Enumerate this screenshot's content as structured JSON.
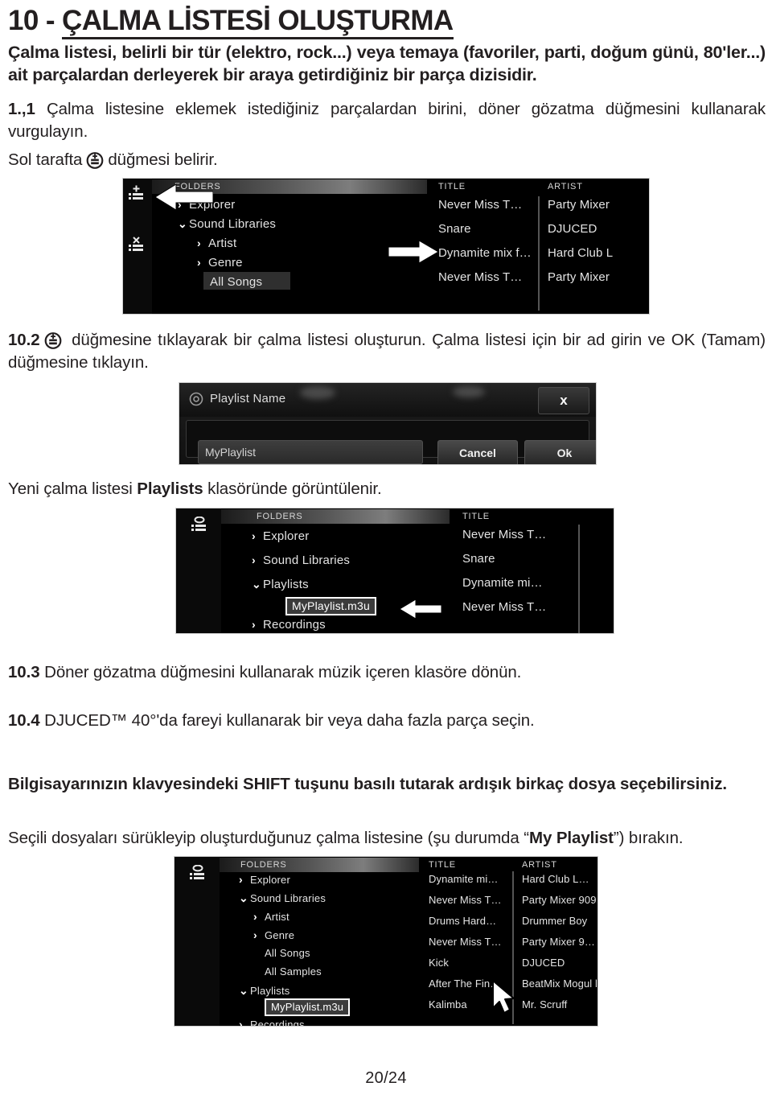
{
  "document": {
    "title": "10 - ÇALMA LİSTESİ OLUŞTURMA",
    "title_prefix": "10 - ",
    "title_underlined": "ÇALMA LİSTESİ OLUŞTURMA",
    "page_number": "20/24"
  },
  "intro": {
    "text": "Çalma listesi, belirli bir tür (elektro, rock...) veya temaya (favoriler, parti, doğum günü, 80'ler...) ait parçalardan derleyerek bir araya getirdiğiniz bir parça dizisidir."
  },
  "steps": {
    "step1": {
      "number": "1.,1",
      "text": "Çalma listesine eklemek istediğiniz parçalardan birini, döner gözatma düğmesini kullanarak vurgulayın.",
      "note_before": "Sol tarafta",
      "note_after": "düğmesi belirir.",
      "icon": "add-playlist-icon"
    },
    "step2": {
      "number": "10.2",
      "icon": "add-playlist-icon",
      "text": "düğmesine tıklayarak bir çalma listesi oluşturun. Çalma listesi için bir ad girin ve OK (Tamam) düğmesine tıklayın."
    },
    "after_step2": {
      "prefix": "Yeni çalma listesi ",
      "bold": "Playlists",
      "suffix": " klasöründe görüntülenir."
    },
    "step3": {
      "number": "10.3",
      "text": "Döner gözatma düğmesini kullanarak müzik içeren klasöre dönün."
    },
    "step4": {
      "number": "10.4",
      "text": "DJUCED™ 40°'da fareyi kullanarak bir veya daha fazla parça seçin."
    },
    "tip": {
      "text": "Bilgisayarınızın klavyesindeki SHIFT tuşunu basılı tutarak ardışık birkaç dosya seçebilirsiniz."
    },
    "drag_note": {
      "prefix": "Seçili dosyaları sürükleyip oluşturduğunuz çalma listesine (şu durumda ",
      "quote_open": "“",
      "bold": "My Playlist",
      "quote_close": "”",
      "suffix": ") bırakın."
    }
  },
  "screenshot1": {
    "name": "djuced-browser-sound-libraries",
    "rail": {
      "add_icon": "add-playlist-icon",
      "delete_icon": "delete-playlist-icon"
    },
    "folders_header": "FOLDERS",
    "tree": [
      {
        "chevron": "›",
        "label": "Explorer",
        "indent": 0,
        "highlight": false
      },
      {
        "chevron": "⌄",
        "label": "Sound Libraries",
        "indent": 0,
        "highlight": false
      },
      {
        "chevron": "›",
        "label": "Artist",
        "indent": 1,
        "highlight": false
      },
      {
        "chevron": "›",
        "label": "Genre",
        "indent": 1,
        "highlight": false
      },
      {
        "chevron": "",
        "label": "All Songs",
        "indent": 1,
        "highlight": true
      }
    ],
    "columns": [
      {
        "header": "TITLE",
        "cells": [
          "Never Miss T…",
          "Snare",
          "Dynamite mix f…",
          "Never Miss T…"
        ]
      },
      {
        "header": "ARTIST",
        "cells": [
          "Party Mixer",
          "DJUCED",
          "Hard Club L",
          "Party Mixer"
        ]
      }
    ],
    "arrows": [
      {
        "name": "arrow-pointing-to-add-playlist-button",
        "direction": "left"
      },
      {
        "name": "arrow-pointing-to-highlighted-track",
        "direction": "right"
      }
    ]
  },
  "dialog": {
    "name": "playlist-name-dialog",
    "title": "Playlist Name",
    "close_label": "x",
    "input_value": "MyPlaylist",
    "cancel_label": "Cancel",
    "ok_label": "Ok"
  },
  "screenshot2": {
    "name": "djuced-browser-playlists-folder",
    "rail": {
      "add_icon": "add-playlist-icon"
    },
    "folders_header": "FOLDERS",
    "tree": [
      {
        "chevron": "›",
        "label": "Explorer",
        "indent": 0
      },
      {
        "chevron": "›",
        "label": "Sound Libraries",
        "indent": 0
      },
      {
        "chevron": "⌄",
        "label": "Playlists",
        "indent": 0
      },
      {
        "chevron": "›",
        "label": "Recordings",
        "indent": 0
      }
    ],
    "selected_file": "MyPlaylist.m3u",
    "columns": [
      {
        "header": "TITLE",
        "cells": [
          "Never Miss T…",
          "Snare",
          "Dynamite mi…",
          "Never Miss T…"
        ]
      }
    ],
    "arrow": {
      "name": "arrow-pointing-to-myplaylist-file",
      "direction": "left"
    }
  },
  "screenshot3": {
    "name": "djuced-browser-drag-tracks-to-playlist",
    "rail": {
      "add_icon": "add-playlist-icon"
    },
    "folders_header": "FOLDERS",
    "tree": [
      {
        "chevron": "›",
        "label": "Explorer",
        "indent": 0
      },
      {
        "chevron": "⌄",
        "label": "Sound Libraries",
        "indent": 0
      },
      {
        "chevron": "›",
        "label": "Artist",
        "indent": 1
      },
      {
        "chevron": "›",
        "label": "Genre",
        "indent": 1
      },
      {
        "chevron": "",
        "label": "All Songs",
        "indent": 1
      },
      {
        "chevron": "",
        "label": "All Samples",
        "indent": 1
      },
      {
        "chevron": "⌄",
        "label": "Playlists",
        "indent": 0
      },
      {
        "chevron": "›",
        "label": "Recordings",
        "indent": 0
      }
    ],
    "selected_file": "MyPlaylist.m3u",
    "columns": [
      {
        "header": "TITLE",
        "cells": [
          "Dynamite mi…",
          "Never Miss T…",
          "Drums Hard…",
          "Never Miss T…",
          "Kick",
          "After The Fin…",
          "Kalimba"
        ]
      },
      {
        "header": "ARTIST",
        "cells": [
          "Hard Club L…",
          "Party Mixer 909",
          "Drummer Boy",
          "Party Mixer 9…",
          "DJUCED",
          "BeatMix Mogul l",
          "Mr. Scruff"
        ]
      }
    ],
    "cursor": {
      "name": "mouse-cursor",
      "visible": true
    }
  },
  "colors": {
    "text": "#231f20",
    "screenshot_bg": "#000000",
    "screenshot_text": "#e3e3e3",
    "highlight": "#2f2f2f",
    "selection_border": "#ffffff"
  }
}
